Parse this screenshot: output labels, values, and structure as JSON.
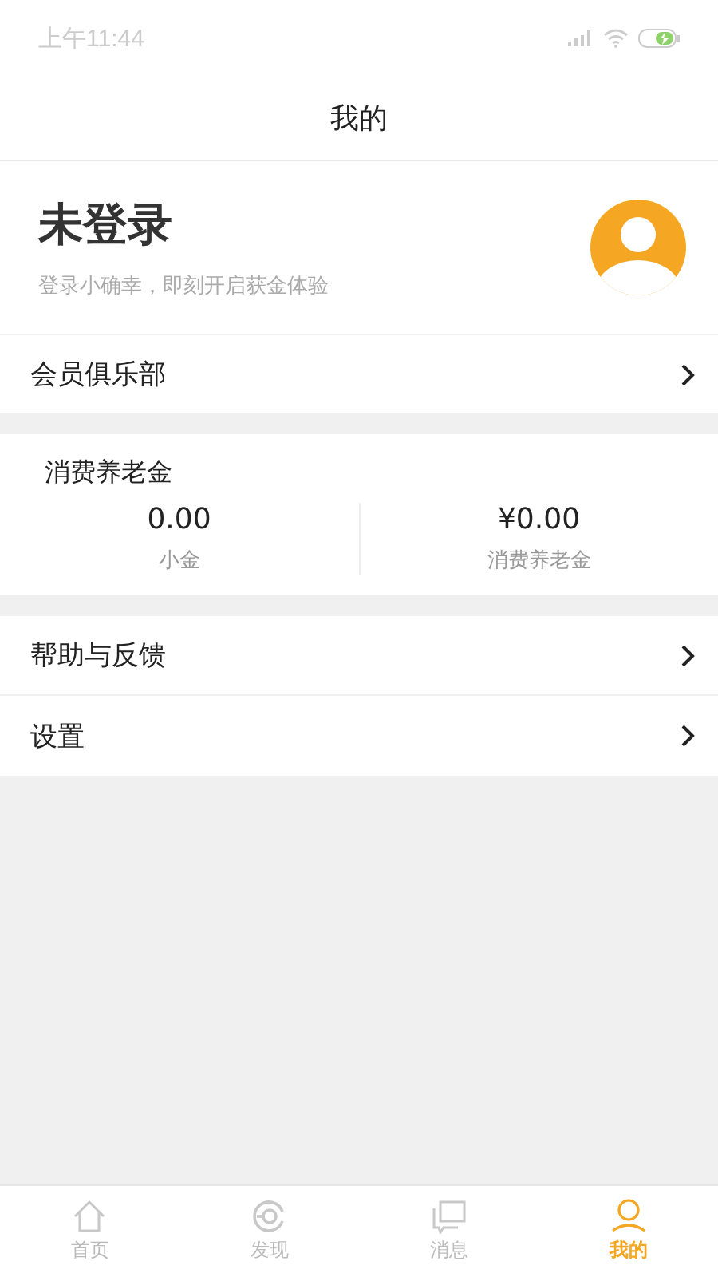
{
  "status_bar": {
    "time": "上午11:44"
  },
  "header": {
    "title": "我的"
  },
  "profile": {
    "name": "未登录",
    "subtitle": "登录小确幸，即刻开启获金体验"
  },
  "club_row": {
    "label": "会员俱乐部"
  },
  "pension": {
    "title": "消费养老金",
    "stats": [
      {
        "value": "0.00",
        "label": "小金"
      },
      {
        "value": "¥0.00",
        "label": "消费养老金"
      }
    ]
  },
  "menu": [
    {
      "label": "帮助与反馈"
    },
    {
      "label": "设置"
    }
  ],
  "tabs": [
    {
      "label": "首页",
      "selected": false
    },
    {
      "label": "发现",
      "selected": false
    },
    {
      "label": "消息",
      "selected": false
    },
    {
      "label": "我的",
      "selected": true
    }
  ]
}
